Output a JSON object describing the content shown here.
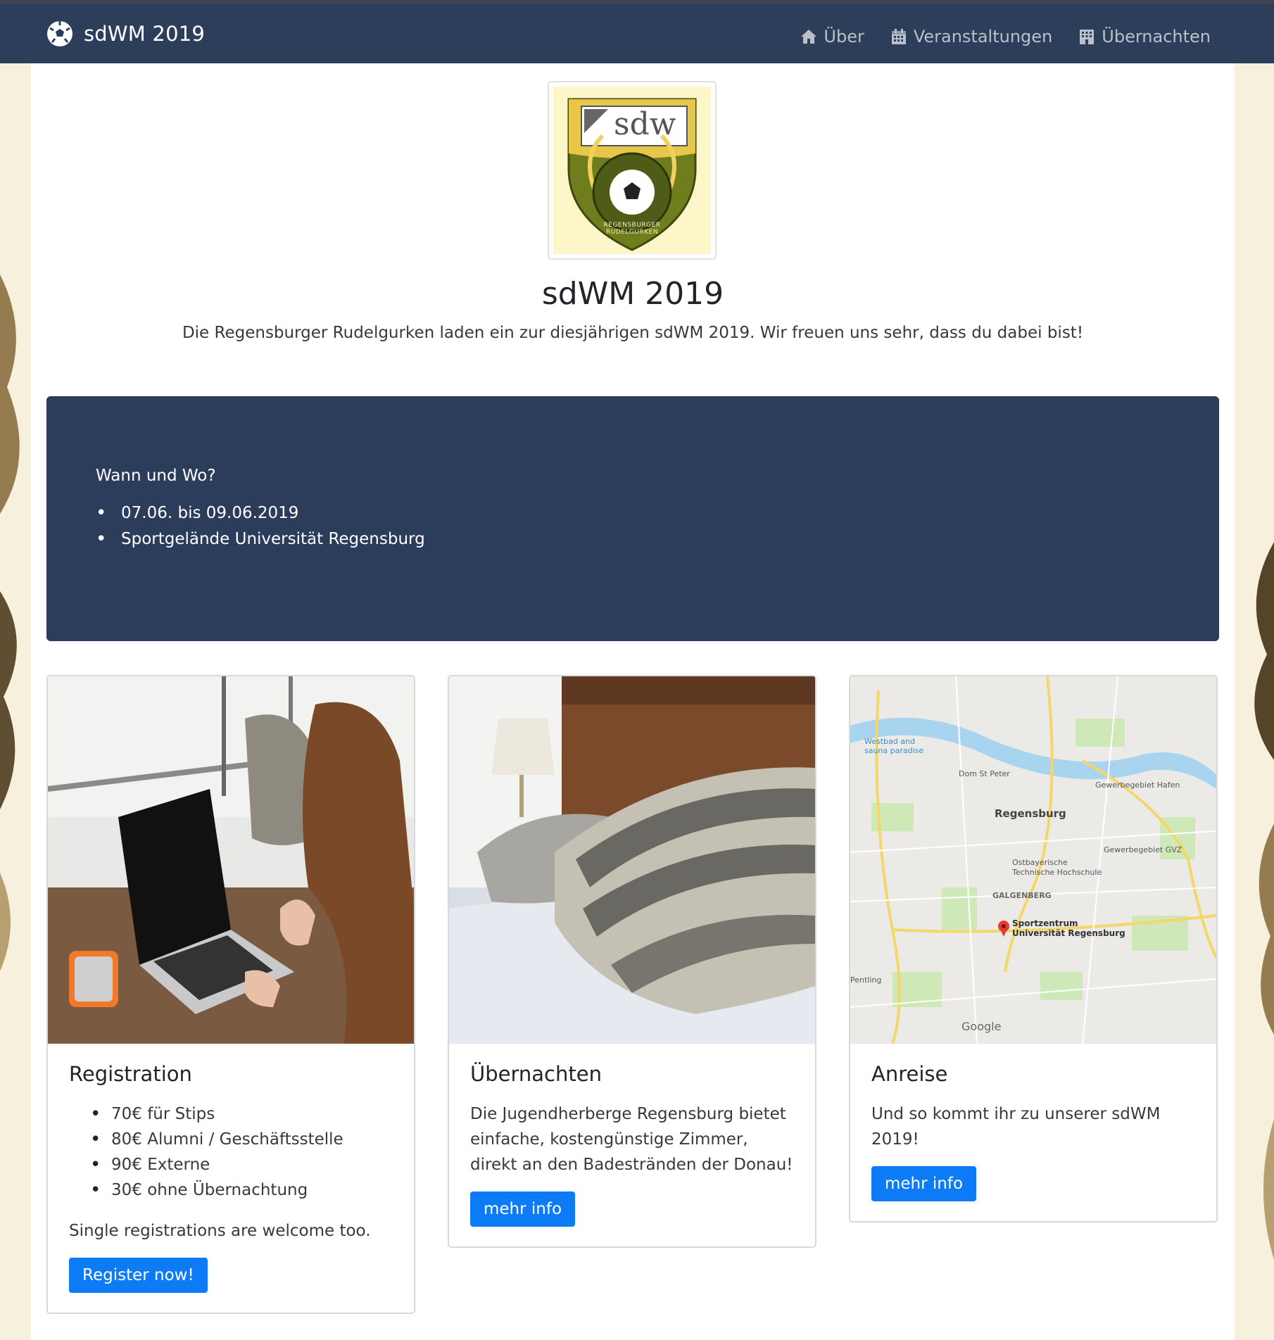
{
  "navbar": {
    "brand": "sdWM 2019",
    "links": [
      {
        "label": "Über",
        "icon": "home-icon"
      },
      {
        "label": "Veranstaltungen",
        "icon": "calendar-icon"
      },
      {
        "label": "Übernachten",
        "icon": "building-icon"
      }
    ]
  },
  "header": {
    "crest_text": "sdw",
    "crest_ring_text": "REGENSBURGER RUDELGURKEN",
    "title": "sdWM 2019",
    "lead": "Die Regensburger Rudelgurken laden ein zur diesjährigen sdWM 2019. Wir freuen uns sehr, dass du dabei bist!"
  },
  "jumbotron": {
    "title": "Wann und Wo?",
    "items": [
      "07.06. bis 09.06.2019",
      "Sportgelände Universität Regensburg"
    ]
  },
  "cards": {
    "registration": {
      "title": "Registration",
      "items": [
        "70€ für Stips",
        "80€ Alumni / Geschäftsstelle",
        "90€ Externe",
        "30€ ohne Übernachtung"
      ],
      "note": "Single registrations are welcome too.",
      "button": "Register now!"
    },
    "accommodation": {
      "title": "Übernachten",
      "text": "Die Jugendherberge Regensburg bietet einfache, kostengünstige Zimmer, direkt an den Badestränden der Donau!",
      "button": "mehr info"
    },
    "travel": {
      "title": "Anreise",
      "text": "Und so kommt ihr zu unserer sdWM 2019!",
      "button": "mehr info",
      "map_labels": {
        "city": "Regensburg",
        "pin_line1": "Sportzentrum",
        "pin_line2": "Universität Regensburg",
        "district": "GALGENBERG",
        "poi1": "Dom St Peter",
        "poi2": "Ostbayerische",
        "poi2b": "Technische Hochschule",
        "poi3": "Gewerbegebiet Hafen",
        "poi4": "Gewerbegebiet GVZ",
        "poi5": "Westbad and",
        "poi5b": "sauna paradise",
        "town": "Pentling",
        "provider": "Google"
      }
    }
  },
  "colors": {
    "navbar": "#2c3e5a",
    "jumbotron": "#2b3d5b",
    "button": "#0d7bf6",
    "page_bg": "#fbf8ea"
  }
}
